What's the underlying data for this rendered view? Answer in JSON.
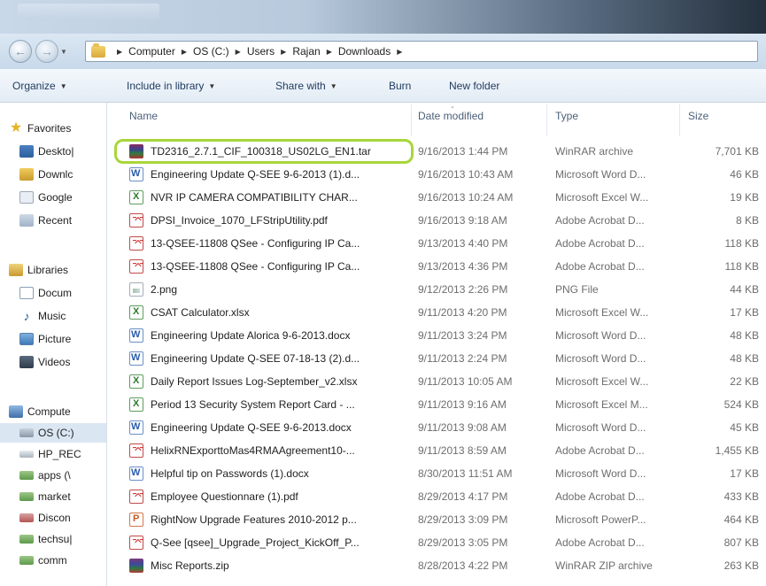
{
  "address_bar": {
    "crumbs": [
      "Computer",
      "OS (C:)",
      "Users",
      "Rajan",
      "Downloads"
    ]
  },
  "toolbar": {
    "organize": "Organize",
    "include_in_library": "Include in library",
    "share_with": "Share with",
    "burn": "Burn",
    "new_folder": "New folder"
  },
  "nav_pane": {
    "favorites": "Favorites",
    "favorites_items": [
      "Deskto|",
      "Downlc",
      "Google",
      "Recent"
    ],
    "libraries": "Libraries",
    "libraries_items": [
      "Docum",
      "Music",
      "Picture",
      "Videos"
    ],
    "computer": "Compute",
    "computer_items": [
      "OS (C:)",
      "HP_REC",
      "apps (\\",
      "market",
      "Discon",
      "techsu|",
      "comm"
    ]
  },
  "columns": {
    "name": "Name",
    "date_modified": "Date modified",
    "type": "Type",
    "size": "Size"
  },
  "files": [
    {
      "icon": "rar-icon",
      "name": "TD2316_2.7.1_CIF_100318_US02LG_EN1.tar",
      "date": "9/16/2013 1:44 PM",
      "type": "WinRAR archive",
      "size": "7,701 KB"
    },
    {
      "icon": "word-icon",
      "name": "Engineering Update Q-SEE 9-6-2013 (1).d...",
      "date": "9/16/2013 10:43 AM",
      "type": "Microsoft Word D...",
      "size": "46 KB"
    },
    {
      "icon": "excel-icon",
      "name": "NVR IP CAMERA COMPATIBILITY CHAR...",
      "date": "9/16/2013 10:24 AM",
      "type": "Microsoft Excel W...",
      "size": "19 KB"
    },
    {
      "icon": "pdf-icon",
      "name": "DPSI_Invoice_1070_LFStripUtility.pdf",
      "date": "9/16/2013 9:18 AM",
      "type": "Adobe Acrobat D...",
      "size": "8 KB"
    },
    {
      "icon": "pdf-icon",
      "name": "13-QSEE-11808 QSee - Configuring IP Ca...",
      "date": "9/13/2013 4:40 PM",
      "type": "Adobe Acrobat D...",
      "size": "118 KB"
    },
    {
      "icon": "pdf-icon",
      "name": "13-QSEE-11808 QSee - Configuring IP Ca...",
      "date": "9/13/2013 4:36 PM",
      "type": "Adobe Acrobat D...",
      "size": "118 KB"
    },
    {
      "icon": "png-icon",
      "name": "2.png",
      "date": "9/12/2013 2:26 PM",
      "type": "PNG File",
      "size": "44 KB"
    },
    {
      "icon": "excel-icon",
      "name": "CSAT Calculator.xlsx",
      "date": "9/11/2013 4:20 PM",
      "type": "Microsoft Excel W...",
      "size": "17 KB"
    },
    {
      "icon": "word-icon",
      "name": "Engineering Update Alorica 9-6-2013.docx",
      "date": "9/11/2013 3:24 PM",
      "type": "Microsoft Word D...",
      "size": "48 KB"
    },
    {
      "icon": "word-icon",
      "name": "Engineering Update Q-SEE 07-18-13 (2).d...",
      "date": "9/11/2013 2:24 PM",
      "type": "Microsoft Word D...",
      "size": "48 KB"
    },
    {
      "icon": "excel-icon",
      "name": "Daily Report Issues Log-September_v2.xlsx",
      "date": "9/11/2013 10:05 AM",
      "type": "Microsoft Excel W...",
      "size": "22 KB"
    },
    {
      "icon": "excel-icon",
      "name": "Period 13 Security System Report Card - ...",
      "date": "9/11/2013 9:16 AM",
      "type": "Microsoft Excel M...",
      "size": "524 KB"
    },
    {
      "icon": "word-icon",
      "name": "Engineering Update Q-SEE 9-6-2013.docx",
      "date": "9/11/2013 9:08 AM",
      "type": "Microsoft Word D...",
      "size": "45 KB"
    },
    {
      "icon": "pdf-icon",
      "name": "HelixRNExporttoMas4RMAAgreement10-...",
      "date": "9/11/2013 8:59 AM",
      "type": "Adobe Acrobat D...",
      "size": "1,455 KB"
    },
    {
      "icon": "word-icon",
      "name": "Helpful tip on Passwords (1).docx",
      "date": "8/30/2013 11:51 AM",
      "type": "Microsoft Word D...",
      "size": "17 KB"
    },
    {
      "icon": "pdf-icon",
      "name": "Employee Questionnare (1).pdf",
      "date": "8/29/2013 4:17 PM",
      "type": "Adobe Acrobat D...",
      "size": "433 KB"
    },
    {
      "icon": "ppt-icon",
      "name": "RightNow Upgrade Features 2010-2012 p...",
      "date": "8/29/2013 3:09 PM",
      "type": "Microsoft PowerP...",
      "size": "464 KB"
    },
    {
      "icon": "pdf-icon",
      "name": "Q-See [qsee]_Upgrade_Project_KickOff_P...",
      "date": "8/29/2013 3:05 PM",
      "type": "Adobe Acrobat D...",
      "size": "807 KB"
    },
    {
      "icon": "zip-icon",
      "name": "Misc Reports.zip",
      "date": "8/28/2013 4:22 PM",
      "type": "WinRAR ZIP archive",
      "size": "263 KB"
    }
  ],
  "colors": {
    "highlight_outline": "#a8d63a",
    "selected_nav": "#dbe6f3"
  }
}
